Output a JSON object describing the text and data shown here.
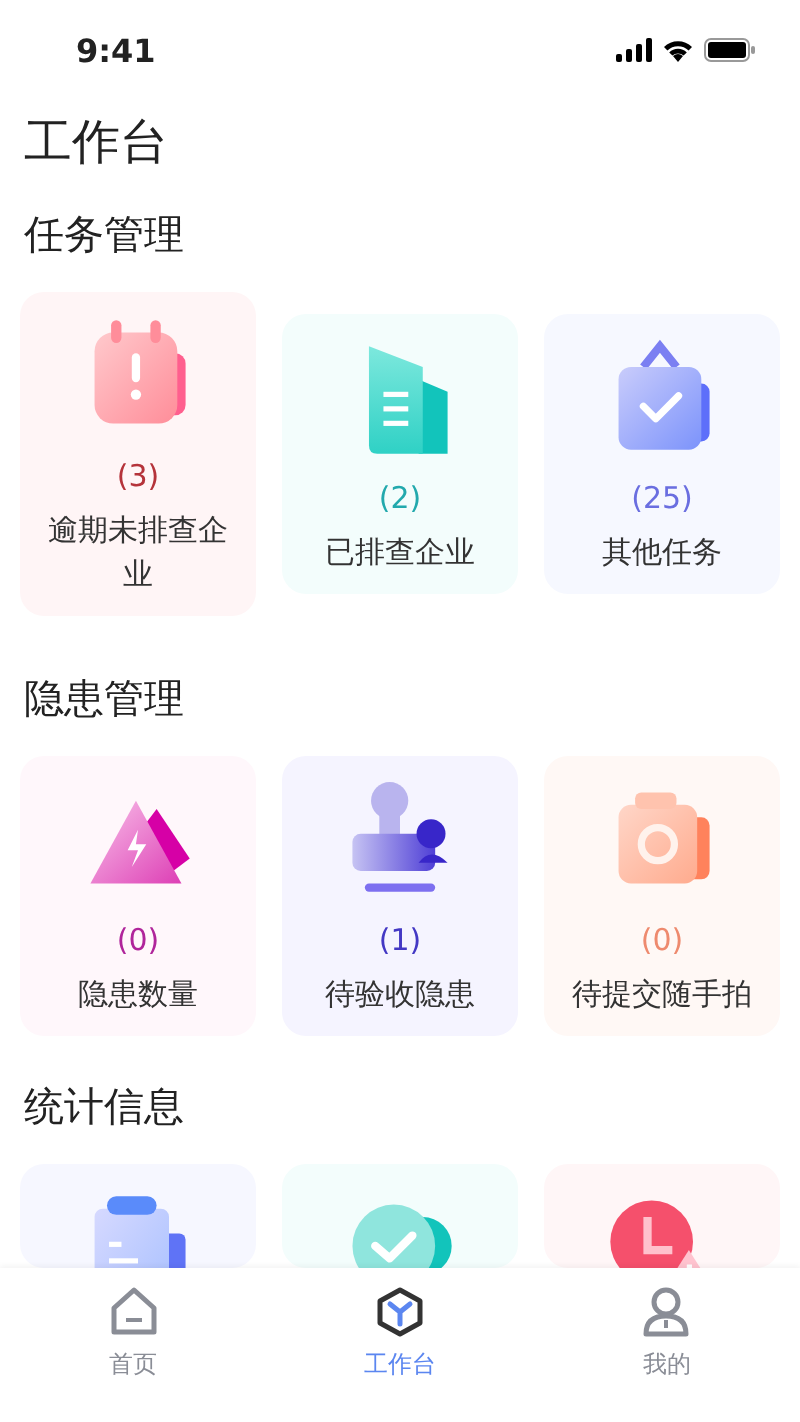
{
  "status_bar": {
    "time": "9:41"
  },
  "title": "工作台",
  "sections": [
    {
      "title": "任务管理",
      "cards": [
        {
          "kind": "calendar",
          "count": "(3)",
          "color": "#b5333a",
          "label": "逾期未排查企业"
        },
        {
          "kind": "document",
          "count": "(2)",
          "color": "#22a9ad",
          "label": "已排查企业"
        },
        {
          "kind": "board",
          "count": "(25)",
          "color": "#6a6ee0",
          "label": "其他任务"
        }
      ]
    },
    {
      "title": "隐患管理",
      "cards": [
        {
          "kind": "warning",
          "count": "(0)",
          "color": "#b0259b",
          "label": "隐患数量"
        },
        {
          "kind": "stamp",
          "count": "(1)",
          "color": "#4338c4",
          "label": "待验收隐患"
        },
        {
          "kind": "camera",
          "count": "(0)",
          "color": "#ee8a6e",
          "label": "待提交随手拍"
        }
      ]
    },
    {
      "title": "统计信息",
      "cards": [
        {
          "kind": "clipboard"
        },
        {
          "kind": "check"
        },
        {
          "kind": "clock"
        }
      ]
    }
  ],
  "tab_bar": [
    {
      "kind": "home",
      "label": "首页",
      "selected": false
    },
    {
      "kind": "cube",
      "label": "工作台",
      "selected": true
    },
    {
      "kind": "user",
      "label": "我的",
      "selected": false
    }
  ]
}
